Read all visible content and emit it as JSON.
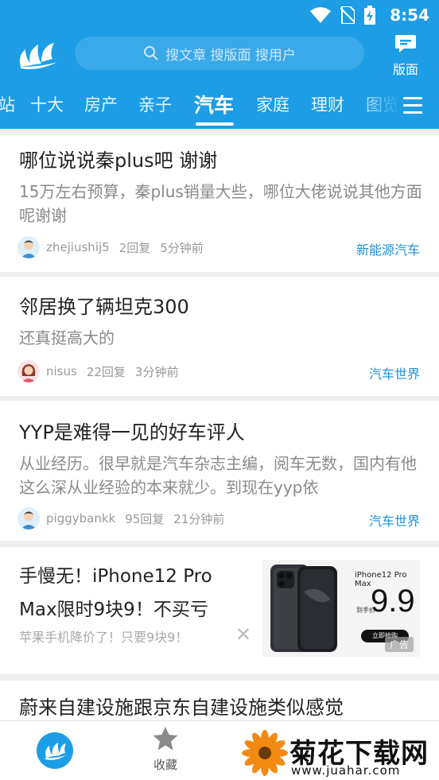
{
  "status_bar": {
    "time": "8:54"
  },
  "header": {
    "search_placeholder": "搜文章 搜版面 搜用户",
    "board_label": "版面"
  },
  "tabs": [
    {
      "label": "站",
      "active": false
    },
    {
      "label": "十大",
      "active": false
    },
    {
      "label": "房产",
      "active": false
    },
    {
      "label": "亲子",
      "active": false
    },
    {
      "label": "汽车",
      "active": true
    },
    {
      "label": "家庭",
      "active": false
    },
    {
      "label": "理财",
      "active": false
    },
    {
      "label": "图览",
      "active": false
    }
  ],
  "posts": [
    {
      "title": "哪位说说秦plus吧 谢谢",
      "body": "15万左右预算，秦plus销量大些，哪位大佬说说其他方面呢谢谢",
      "user": "zhejiushij5",
      "replies": "2回复",
      "time": "5分钟前",
      "tag": "新能源汽车",
      "avatar": "male-avatar-icon"
    },
    {
      "title": "邻居换了辆坦克300",
      "body": "还真挺高大的",
      "user": "nisus",
      "replies": "22回复",
      "time": "3分钟前",
      "tag": "汽车世界",
      "avatar": "female-avatar-icon"
    },
    {
      "title": "YYP是难得一见的好车评人",
      "body": "从业经历。很早就是汽车杂志主编，阅车无数，国内有他这么深从业经验的本来就少。到现在yyp依",
      "user": "piggybankk",
      "replies": "95回复",
      "time": "21分钟前",
      "tag": "汽车世界",
      "avatar": "male-avatar-icon"
    }
  ],
  "ad": {
    "title": "手慢无！iPhone12 Pro Max限时9块9！不买亏",
    "subtitle": "苹果手机降价了！只要9块9！",
    "close": "✕",
    "image": {
      "product": "iPhone12 Pro Max",
      "price": "9.9",
      "price_label": "到手价",
      "buy_label": "立即抢购",
      "badge": "广告"
    }
  },
  "partial_post": {
    "title": "蔚来自建设施跟京东自建设施类似感觉"
  },
  "bottom_nav": {
    "favorites_label": "收藏"
  },
  "watermark": {
    "title": "菊花下载网",
    "url": "www.juahar.com"
  },
  "colors": {
    "primary": "#1c9de6",
    "tag": "#1c8fd8"
  }
}
